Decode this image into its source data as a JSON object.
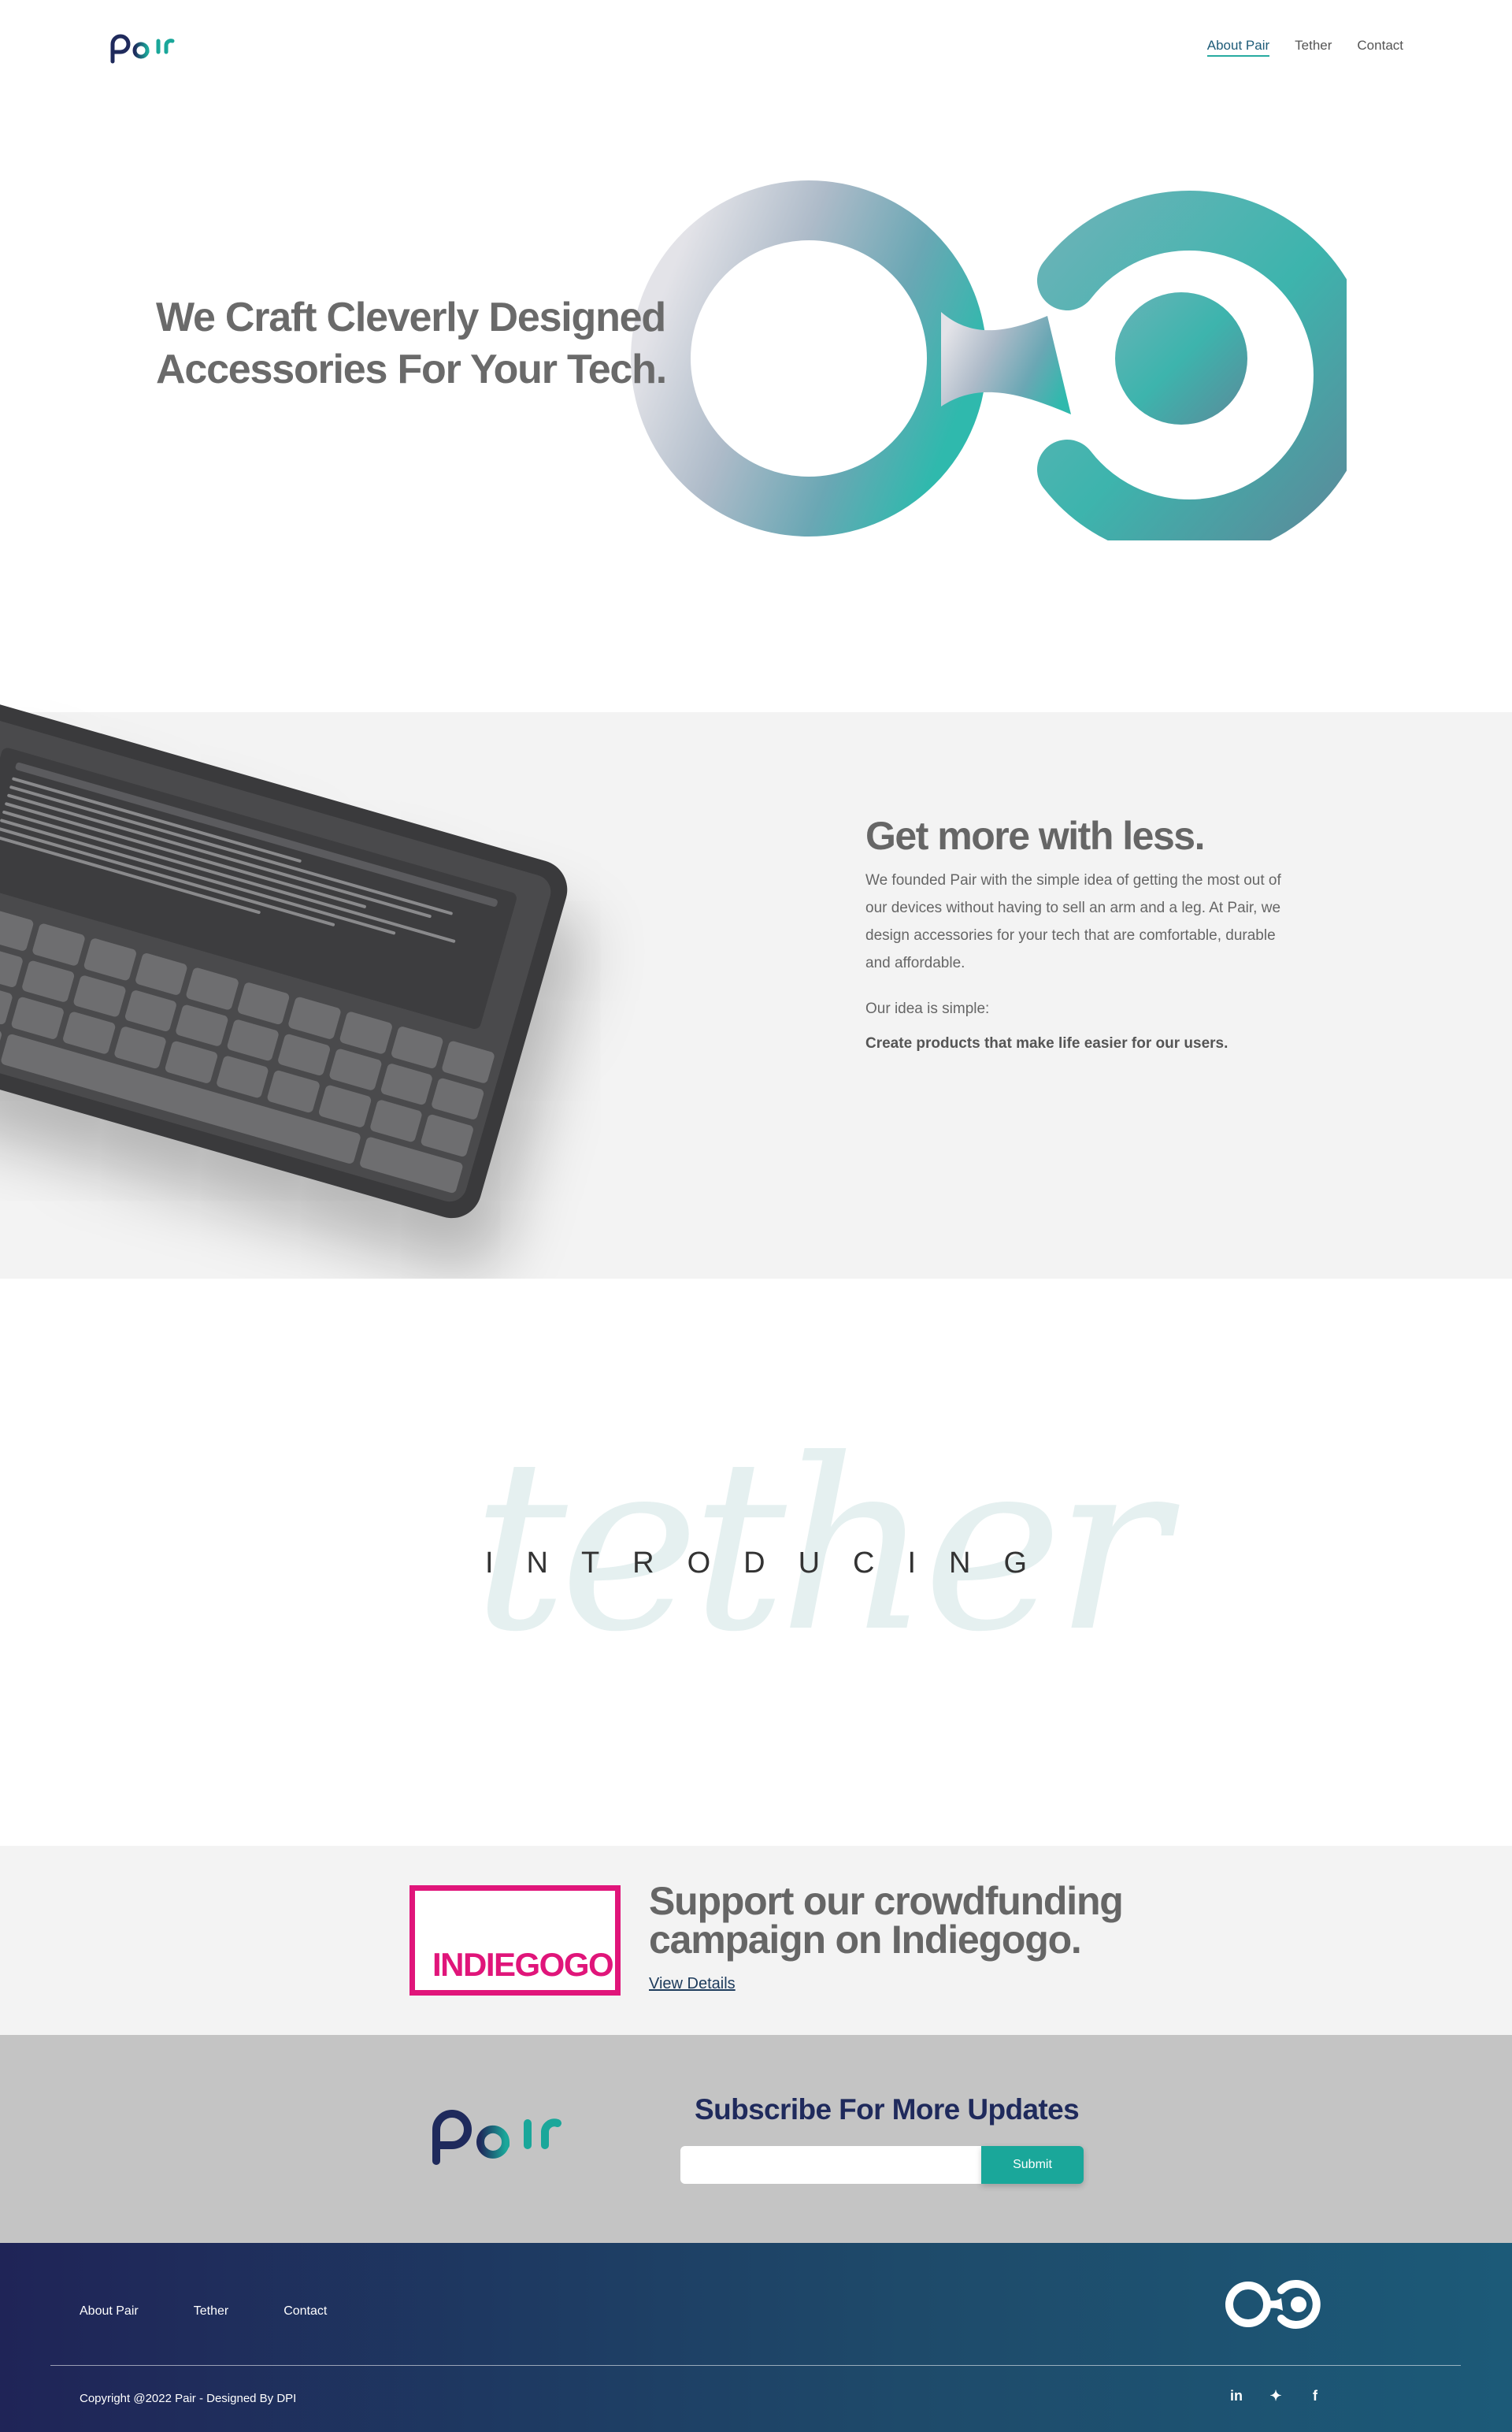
{
  "header": {
    "logo_text": "pair",
    "nav": [
      "About Pair",
      "Tether",
      "Contact"
    ]
  },
  "hero": {
    "title": "We Craft Cleverly Designed Accessories For Your Tech."
  },
  "less": {
    "title": "Get more with less.",
    "text": "We founded Pair with the simple idea of getting the most out of our devices without having to sell an arm and a leg. At Pair, we design accessories for your tech that are comfortable, durable and affordable.",
    "idea_label": "Our idea is simple:",
    "idea_text": "Create products that make life easier for our users."
  },
  "intro": {
    "script_word": "tether",
    "word": "INTRODUCING"
  },
  "indiegogo": {
    "logo_text": "INDIEGOGO.",
    "title": "Support our crowdfunding campaign on Indiegogo.",
    "link": "View Details"
  },
  "subscribe": {
    "logo_text": "pair",
    "title": "Subscribe For More Updates",
    "input_value": "",
    "button": "Submit"
  },
  "footer": {
    "nav": [
      "About Pair",
      "Tether",
      "Contact"
    ],
    "copyright": "Copyright @2022 Pair - Designed By DPI",
    "socials": [
      "linkedin-icon",
      "twitter-icon",
      "facebook-icon"
    ]
  },
  "colors": {
    "accent": "#1aa79a",
    "brand_navy": "#1f2a5c",
    "indiegogo_pink": "#e0157a"
  }
}
